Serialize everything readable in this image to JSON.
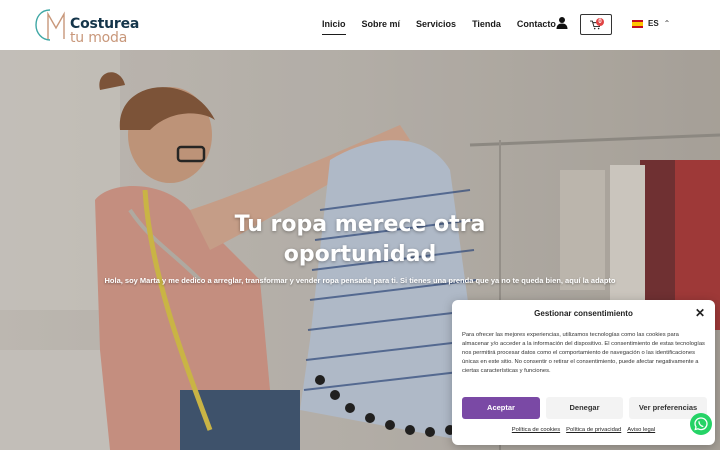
{
  "header": {
    "logo": {
      "line1": "Costurea",
      "line2": "tu moda"
    },
    "nav": [
      {
        "label": "Inicio",
        "active": true
      },
      {
        "label": "Sobre mí",
        "active": false
      },
      {
        "label": "Servicios",
        "active": false
      },
      {
        "label": "Tienda",
        "active": false
      },
      {
        "label": "Contacto",
        "active": false
      }
    ],
    "cart_count": "0",
    "language": "ES"
  },
  "hero": {
    "title_line1": "Tu ropa merece otra",
    "title_line2": "oportunidad",
    "subtitle": "Hola, soy Marta y me dedico a arreglar, transformar y vender ropa pensada para ti. Si tienes una prenda que ya no te queda bien, aquí la adapto"
  },
  "consent": {
    "title": "Gestionar consentimiento",
    "body": "Para ofrecer las mejores experiencias, utilizamos tecnologías como las cookies para almacenar y/o acceder a la información del dispositivo. El consentimiento de estas tecnologías nos permitirá procesar datos como el comportamiento de navegación o las identificaciones únicas en este sitio. No consentir o retirar el consentimiento, puede afectar negativamente a ciertas características y funciones.",
    "accept_label": "Aceptar",
    "deny_label": "Denegar",
    "prefs_label": "Ver preferencias",
    "links": [
      "Política de cookies",
      "Política de privacidad",
      "Aviso legal"
    ]
  },
  "colors": {
    "accent": "#7a49a5",
    "logo_dark": "#14354a",
    "logo_light": "#c8977a",
    "whatsapp": "#25d366"
  }
}
